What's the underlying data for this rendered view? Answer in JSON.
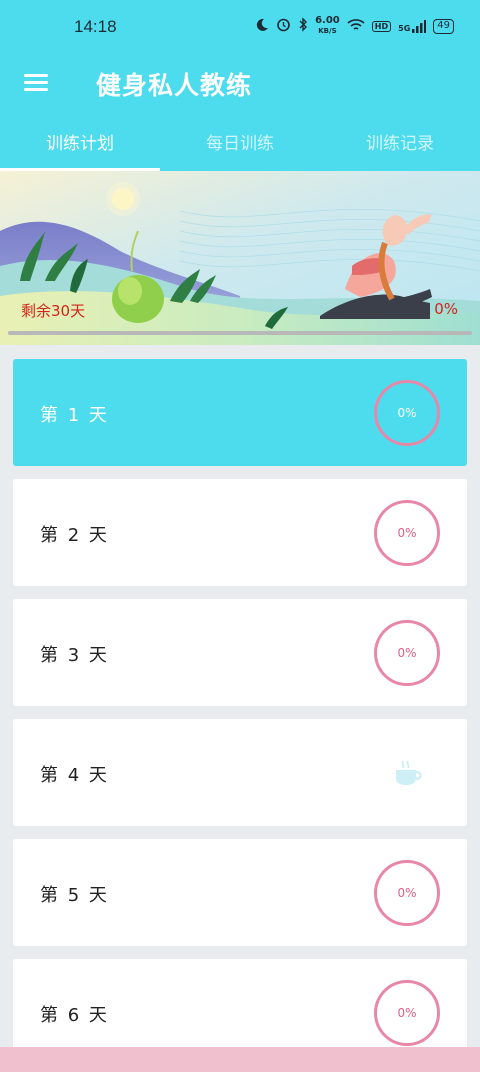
{
  "status_bar": {
    "time": "14:18",
    "speed_value": "6.00",
    "speed_unit": "KB/S",
    "hd": "HD",
    "network": "5G",
    "battery": "49"
  },
  "app": {
    "title": "健身私人教练"
  },
  "tabs": [
    {
      "label": "训练计划",
      "active": true
    },
    {
      "label": "每日训练",
      "active": false
    },
    {
      "label": "训练记录",
      "active": false
    }
  ],
  "banner": {
    "remaining_text": "剩余30天",
    "overall_percent_text": "0%",
    "overall_progress": 0
  },
  "days": [
    {
      "label": "第 1 天",
      "status": "0%",
      "active": true
    },
    {
      "label": "第 2 天",
      "status": "0%",
      "active": false
    },
    {
      "label": "第 3 天",
      "status": "0%",
      "active": false
    },
    {
      "label": "第 4 天",
      "status": "rest",
      "icon": "coffee-cup-icon",
      "active": false
    },
    {
      "label": "第 5 天",
      "status": "0%",
      "active": false
    },
    {
      "label": "第 6 天",
      "status": "0%",
      "active": false
    }
  ],
  "colors": {
    "primary": "#4ddbee",
    "ring": "#e888a8",
    "warning_text": "#d1251a"
  }
}
